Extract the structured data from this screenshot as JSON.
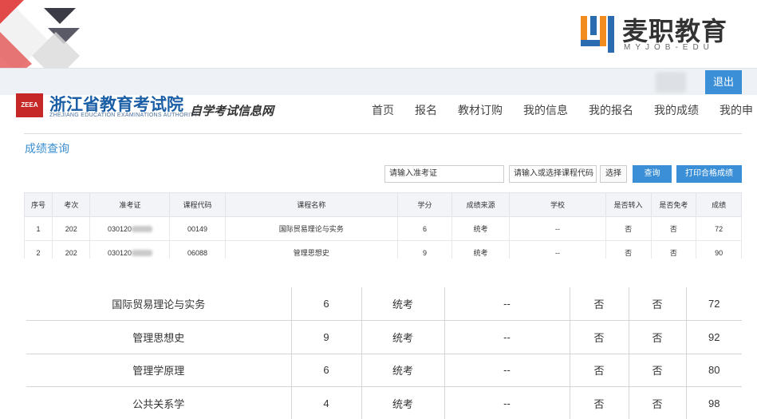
{
  "brand": {
    "name": "麦职教育",
    "sub": "MYJOB-EDU"
  },
  "topbar": {
    "logout_label": "退出"
  },
  "site": {
    "logo_text": "ZEEA",
    "title": "浙江省教育考试院",
    "title_en": "ZHEJIANG EDUCATION EXAMINATIONS AUTHORITY",
    "subtitle": "自学考试信息网"
  },
  "nav": [
    "首页",
    "报名",
    "教材订购",
    "我的信息",
    "我的报名",
    "我的成绩",
    "我的申"
  ],
  "section_title": "成绩查询",
  "search": {
    "exam_no_placeholder": "请输入准考证",
    "course_placeholder": "请输入或选择课程代码",
    "select_label": "选择",
    "query_label": "查询",
    "print_label": "打印合格成绩"
  },
  "small_table": {
    "headers": [
      "序号",
      "考次",
      "准考证",
      "课程代码",
      "课程名称",
      "学分",
      "成绩来源",
      "学校",
      "是否转入",
      "是否免考",
      "成绩"
    ],
    "rows": [
      [
        "1",
        "202",
        "030120",
        "00149",
        "国际贸易理论与实务",
        "6",
        "统考",
        "--",
        "否",
        "否",
        "72"
      ],
      [
        "2",
        "202",
        "030120",
        "06088",
        "管理思想史",
        "9",
        "统考",
        "--",
        "否",
        "否",
        "90"
      ]
    ]
  },
  "big_table": {
    "rows": [
      [
        "国际贸易理论与实务",
        "6",
        "统考",
        "--",
        "否",
        "否",
        "72"
      ],
      [
        "管理思想史",
        "9",
        "统考",
        "--",
        "否",
        "否",
        "92"
      ],
      [
        "管理学原理",
        "6",
        "统考",
        "--",
        "否",
        "否",
        "80"
      ],
      [
        "公共关系学",
        "4",
        "统考",
        "--",
        "否",
        "否",
        "98"
      ]
    ]
  },
  "colors": {
    "accent": "#3a8fd6",
    "title_blue": "#1a5ea6",
    "logo_red": "#c62828",
    "brand_orange": "#f28c1e"
  }
}
